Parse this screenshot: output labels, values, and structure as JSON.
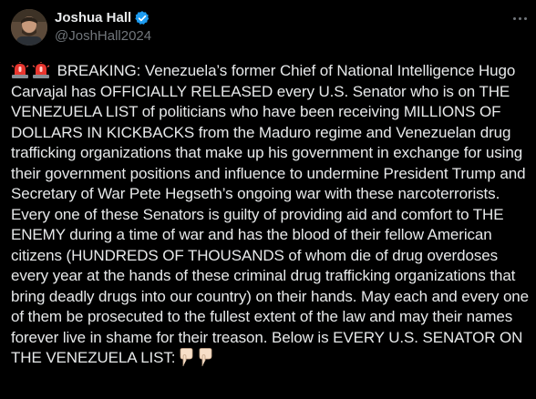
{
  "author": {
    "display_name": "Joshua Hall",
    "handle": "@JoshHall2024",
    "verified": true
  },
  "post": {
    "lead_icons": [
      "rotating-light-icon",
      "rotating-light-icon"
    ],
    "text": "BREAKING: Venezuela’s former Chief of National Intelligence Hugo Carvajal has OFFICIALLY RELEASED every U.S. Senator who is on THE VENEZUELA LIST of politicians who have been receiving MILLIONS OF DOLLARS IN KICKBACKS from the Maduro regime and Venezuelan drug trafficking organizations that make up his government in exchange for using their government positions and influence to undermine President Trump and Secretary of War Pete Hegseth’s ongoing war with these narcoterrorists. Every one of these Senators is guilty of providing aid and comfort to THE ENEMY during a time of war and has the blood of their fellow American citizens (HUNDREDS OF THOUSANDS of whom die of drug overdoses every year at the hands of these criminal drug trafficking organizations that bring deadly drugs into our country) on their hands. May each and every one of them be prosecuted to the fullest extent of the law and may their names forever live in shame for their treason. Below is EVERY U.S. SENATOR ON THE VENEZUELA LIST:",
    "trail_icons": [
      "pointing-down-icon",
      "pointing-down-icon"
    ]
  },
  "colors": {
    "background": "#000000",
    "text": "#e7e9ea",
    "muted": "#71767b",
    "verified": "#1d9bf0"
  }
}
